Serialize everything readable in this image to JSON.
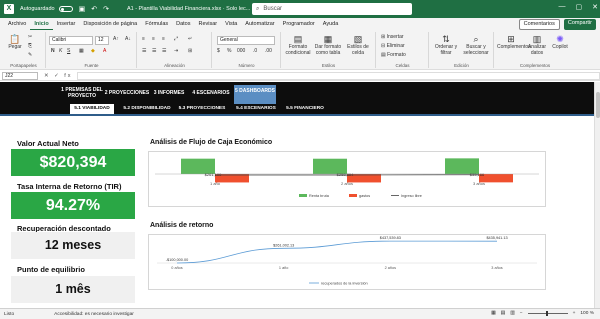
{
  "app": {
    "logo": "X",
    "autosave_label": "Autoguardado",
    "doc_title": "A1 - Plantilla Viabilidad Financiera.xlsx  ·  Solo lec...",
    "search_placeholder": "Buscar",
    "brand_color": "#1f6f43"
  },
  "menu": {
    "tabs": [
      "Archivo",
      "Inicio",
      "Insertar",
      "Disposición de página",
      "Fórmulas",
      "Datos",
      "Revisar",
      "Vista",
      "Automatizar",
      "Programador",
      "Ayuda"
    ],
    "active_tab": "Inicio",
    "comments_label": "Comentarios",
    "share_label": "Compartir"
  },
  "ribbon": {
    "groups": [
      "Portapapeles",
      "Fuente",
      "Alineación",
      "Número",
      "Estilos",
      "Celdas",
      "Edición",
      "Complementos"
    ],
    "font_name": "Calibri",
    "font_size": "12",
    "number_format": "General",
    "paste_label": "Pegar",
    "cond_format_label": "Formato condicional",
    "table_format_label": "Dar formato como tabla",
    "cell_styles_label": "Estilos de celda",
    "insert_label": "Insertar",
    "delete_label": "Eliminar",
    "format_label": "Formato",
    "sort_label": "Ordenar y filtrar",
    "find_label": "Buscar y seleccionar",
    "addins_label": "Complementos",
    "analyze_label": "Analizar datos",
    "copilot_label": "Copilot"
  },
  "formula_bar": {
    "cell_ref": "J22",
    "fx_symbol": "fx",
    "value": ""
  },
  "nav": {
    "top_items": [
      {
        "label": "1 PREMISAS DEL PROYECTO",
        "active": false
      },
      {
        "label": "2 PROYECCIONES",
        "active": false
      },
      {
        "label": "3 INFORMES",
        "active": false
      },
      {
        "label": "4 ESCENARIOS",
        "active": false
      },
      {
        "label": "5 DASHBOARDS",
        "active": true
      }
    ],
    "sub_items": [
      {
        "label": "5.1 VIABILIDAD",
        "active": true
      },
      {
        "label": "5.2 DISPONIBILIDAD",
        "active": false
      },
      {
        "label": "5.3 PROYECCIONES",
        "active": false
      },
      {
        "label": "5.4 ESCENARIOS",
        "active": false
      },
      {
        "label": "5.5 FINANCIERO",
        "active": false
      }
    ]
  },
  "kpis": [
    {
      "label": "Valor Actual Neto",
      "value": "$820,394",
      "style": "green"
    },
    {
      "label": "Tasa Interna de Retorno (TIR)",
      "value": "94.27%",
      "style": "green"
    },
    {
      "label": "Recuperación descontado",
      "value": "12 meses",
      "style": "gray"
    },
    {
      "label": "Punto de equilibrio",
      "value": "1 mês",
      "style": "gray"
    }
  ],
  "chart_data": [
    {
      "type": "bar",
      "title": "Análisis de Flujo de Caja Económico",
      "categories": [
        "1 año",
        "2 años",
        "3 años"
      ],
      "series": [
        {
          "name": "Renta bruta",
          "color": "#5cb85c",
          "values": [
            345000,
            344000,
            352000
          ]
        },
        {
          "name": "gastos",
          "color": "#f0502e",
          "values": [
            -190000,
            -190000,
            -188000
          ]
        },
        {
          "name": "Ingreso libre",
          "color": "#404040",
          "values": [
            155000,
            154000,
            164000
          ]
        }
      ],
      "data_labels": [
        "$261,100",
        "$258,894",
        "$33,166"
      ],
      "legend": "bottom"
    },
    {
      "type": "line",
      "title": "Análisis de retorno",
      "categories": [
        "0 años",
        "1 año",
        "2 años",
        "3 años"
      ],
      "series": [
        {
          "name": "recuperados de la inversión",
          "color": "#5b9bd5",
          "values": [
            -100000,
            261101,
            437539,
            435941
          ]
        }
      ],
      "data_labels": [
        "-$100,000.00",
        "$261,002.13",
        "$437,539.83",
        "$435,941.13"
      ],
      "legend": "bottom"
    }
  ],
  "status": {
    "ready": "Listo",
    "accessibility": "Accesibilidad: es necesario investigar",
    "zoom": "100 %"
  }
}
